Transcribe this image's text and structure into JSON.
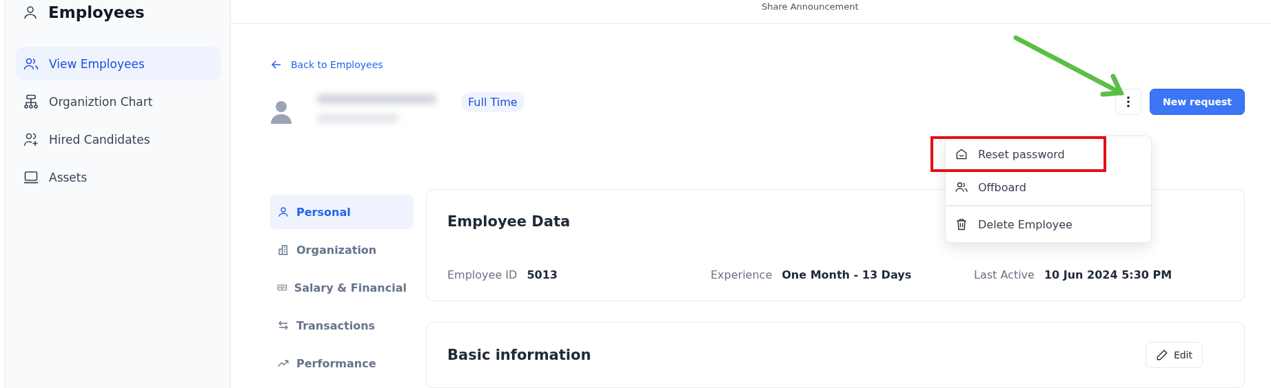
{
  "sidebar": {
    "title": "Employees",
    "items": [
      {
        "label": "View Employees",
        "kind": "users",
        "selected": true
      },
      {
        "label": "Organiztion Chart",
        "kind": "chart",
        "selected": false
      },
      {
        "label": "Hired Candidates",
        "kind": "user-plus",
        "selected": false
      },
      {
        "label": "Assets",
        "kind": "laptop",
        "selected": false
      }
    ]
  },
  "topbar": {
    "share": "Share Announcement"
  },
  "back_link": "Back to Employees",
  "employee": {
    "badge": "Full Time"
  },
  "menu_button": {
    "arrow_annotation": true
  },
  "new_request": "New request",
  "menu": {
    "groups": [
      [
        {
          "label": "Reset password",
          "kind": "reset",
          "highlighted": true
        },
        {
          "label": "Offboard",
          "kind": "offboard",
          "highlighted": false
        }
      ],
      [
        {
          "label": "Delete Employee",
          "kind": "delete",
          "highlighted": false
        }
      ]
    ]
  },
  "tabs": [
    {
      "label": "Personal",
      "kind": "person",
      "selected": true
    },
    {
      "label": "Organization",
      "kind": "building",
      "selected": false
    },
    {
      "label": "Salary & Financial",
      "kind": "money",
      "selected": false
    },
    {
      "label": "Transactions",
      "kind": "swap",
      "selected": false
    },
    {
      "label": "Performance",
      "kind": "trend",
      "selected": false
    }
  ],
  "cards": [
    {
      "title": "Employee Data",
      "fields": [
        {
          "label": "Employee ID",
          "value": "5013"
        },
        {
          "label": "Experience",
          "value": "One Month - 13 Days"
        },
        {
          "label": "Last Active",
          "value": "10 Jun 2024 5:30 PM"
        }
      ]
    },
    {
      "title": "Basic information",
      "action": "Edit"
    }
  ]
}
